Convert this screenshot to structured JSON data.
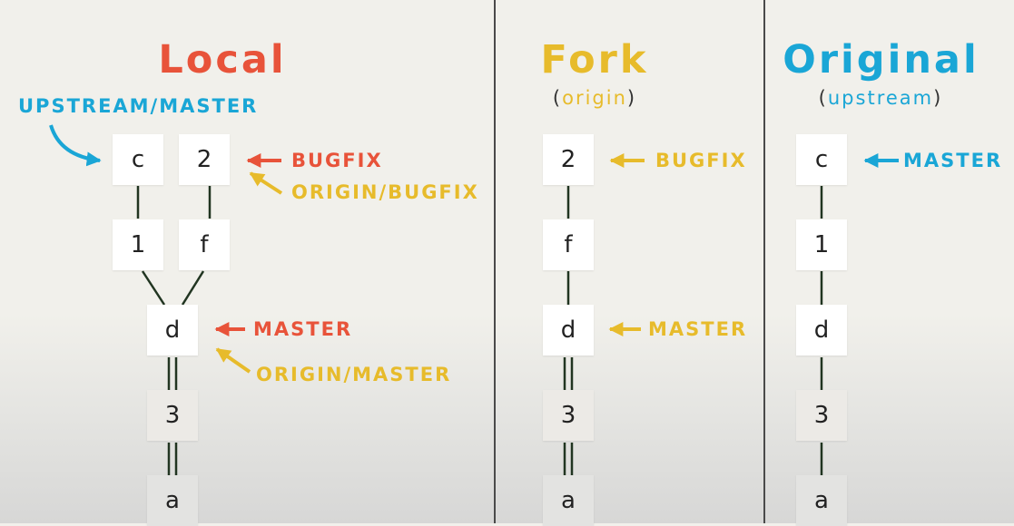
{
  "colors": {
    "red": "#e8533a",
    "yellow": "#e7bb2b",
    "blue": "#1aa6d6",
    "line": "#213521"
  },
  "local": {
    "title": "Local",
    "commits": [
      "c",
      "2",
      "1",
      "f",
      "d",
      "3",
      "a"
    ],
    "labels": {
      "upstream_master": "UPSTREAM/MASTER",
      "bugfix": "BUGFIX",
      "origin_bugfix": "ORIGIN/BUGFIX",
      "master": "MASTER",
      "origin_master": "ORIGIN/MASTER"
    }
  },
  "fork": {
    "title": "Fork",
    "subtitle_open": "(",
    "subtitle_word": "origin",
    "subtitle_close": ")",
    "commits": [
      "2",
      "f",
      "d",
      "3",
      "a"
    ],
    "labels": {
      "bugfix": "BUGFIX",
      "master": "MASTER"
    }
  },
  "original": {
    "title": "Original",
    "subtitle_open": "(",
    "subtitle_word": "upstream",
    "subtitle_close": ")",
    "commits": [
      "c",
      "1",
      "d",
      "3",
      "a"
    ],
    "labels": {
      "master": "MASTER"
    }
  }
}
